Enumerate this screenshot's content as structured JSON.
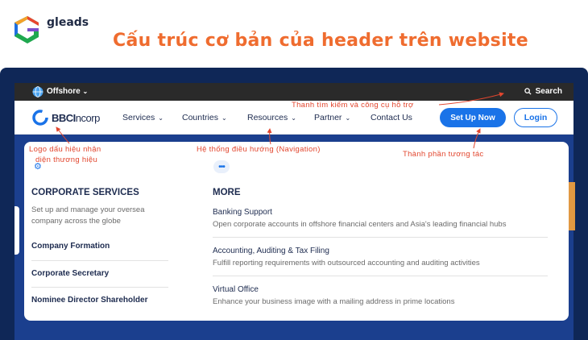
{
  "brand": {
    "name": "gleads"
  },
  "headline": "Cấu trúc cơ bản của header trên website",
  "topbar": {
    "language": "Offshore",
    "search": "Search"
  },
  "nav": {
    "logo": {
      "bold": "BBCI",
      "rest": "ncorp"
    },
    "items": [
      {
        "label": "Services"
      },
      {
        "label": "Countries"
      },
      {
        "label": "Resources"
      },
      {
        "label": "Partner"
      },
      {
        "label": "Contact Us"
      }
    ],
    "signup": "Set Up Now",
    "login": "Login"
  },
  "annotations": {
    "search": "Thanh tìm kiếm và công cụ hỗ trợ",
    "logo_line1": "Logo dấu hiệu nhận",
    "logo_line2": "diện thương hiệu",
    "nav": "Hệ thống điều hướng (Navigation)",
    "interactive": "Thành phần tương tác"
  },
  "dropdown": {
    "left": {
      "title": "CORPORATE SERVICES",
      "description": "Set up and manage your oversea company across the globe",
      "links": [
        "Company Formation",
        "Corporate Secretary",
        "Nominee Director Shareholder"
      ]
    },
    "right": {
      "title": "MORE",
      "items": [
        {
          "title": "Banking Support",
          "desc": "Open corporate accounts in offshore financial centers and Asia's leading financial hubs"
        },
        {
          "title": "Accounting, Auditing & Tax Filing",
          "desc": "Fulfill reporting requirements with outsourced accounting and auditing activities"
        },
        {
          "title": "Virtual Office",
          "desc": "Enhance your business image with a mailing address in prime locations"
        }
      ]
    }
  },
  "colors": {
    "accent": "#1a73e8",
    "headline": "#ef6c2f",
    "annotation": "#e2462e",
    "frame": "#0f2757"
  }
}
